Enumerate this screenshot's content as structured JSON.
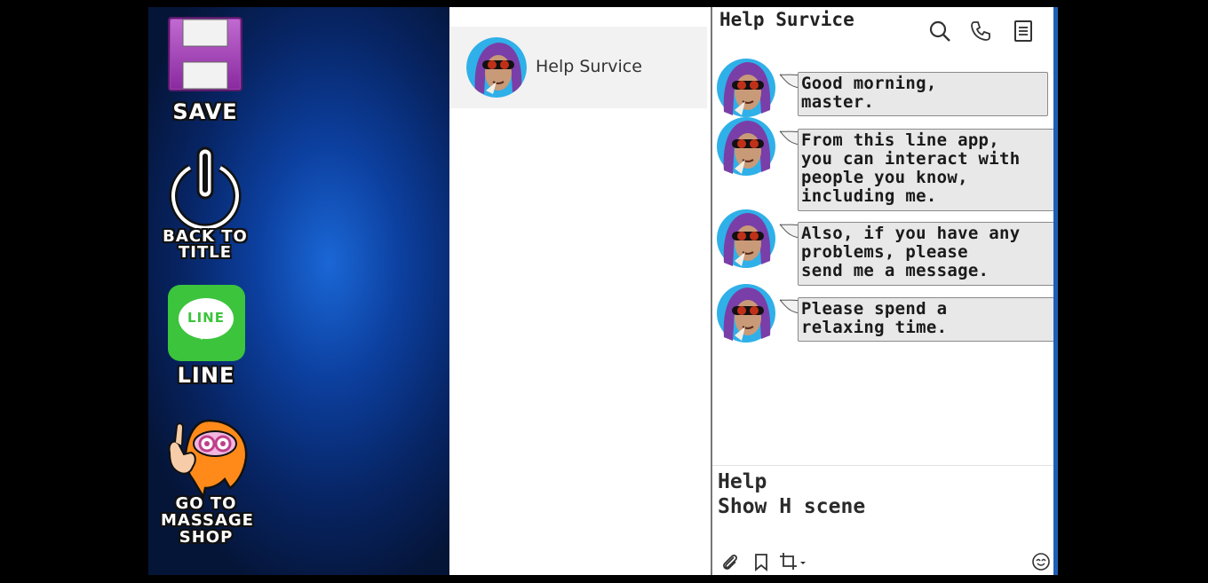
{
  "menu": {
    "save_label": "SAVE",
    "back_line1": "BACK TO",
    "back_line2": "TITLE",
    "line_label": "LINE",
    "line_logo_text": "LINE",
    "massage_line1": "GO TO",
    "massage_line2": "MASSAGE",
    "massage_line3": "SHOP"
  },
  "contacts": [
    {
      "name": "Help Survice"
    }
  ],
  "chat": {
    "title": "Help Survice",
    "header_icons": [
      "search-icon",
      "phone-icon",
      "notes-icon"
    ],
    "messages": [
      {
        "text": "Good morning,\nmaster."
      },
      {
        "text": "From this line app,\nyou can interact with\npeople you know,\nincluding me."
      },
      {
        "text": "Also, if you have any\nproblems, please\nsend me a message."
      },
      {
        "text": "Please spend a\nrelaxing time."
      }
    ],
    "choices": [
      "Help",
      "Show H scene"
    ],
    "toolbar_icons": [
      "paperclip-icon",
      "bookmark-icon",
      "crop-icon",
      "emoji-icon"
    ]
  },
  "colors": {
    "line_green": "#3cc43c",
    "save_purple": "#a04db0",
    "background_blue": "#0c3f9e"
  }
}
